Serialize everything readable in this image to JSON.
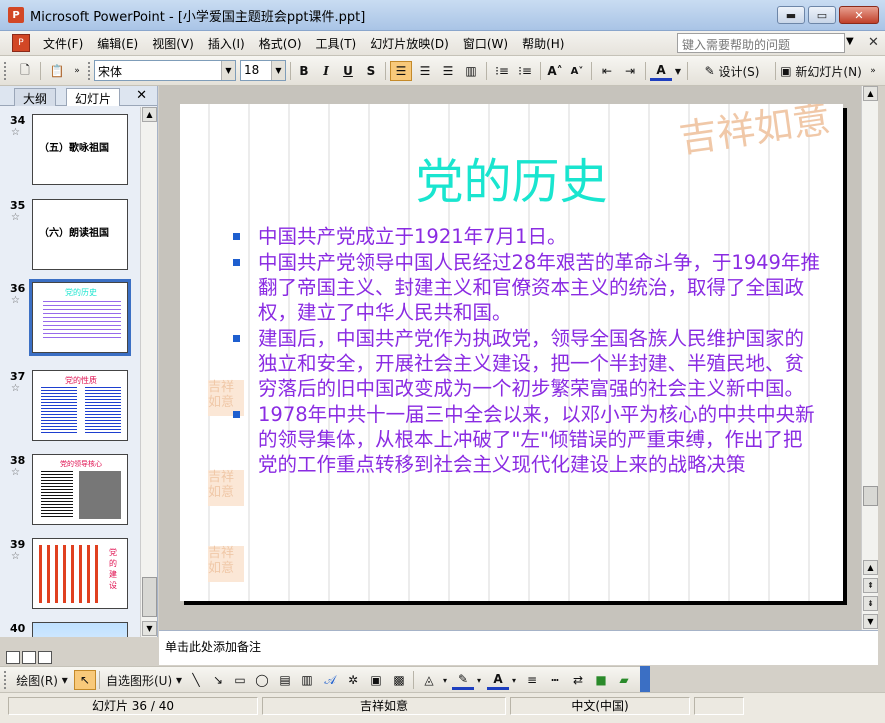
{
  "window": {
    "title": "Microsoft PowerPoint - [小学爱国主题班会ppt课件.ppt]",
    "minimize_label": "▭",
    "restore_label": "⧉",
    "close_label": "✕"
  },
  "menu": {
    "items": [
      "文件(F)",
      "编辑(E)",
      "视图(V)",
      "插入(I)",
      "格式(O)",
      "工具(T)",
      "幻灯片放映(D)",
      "窗口(W)",
      "帮助(H)"
    ],
    "help_placeholder": "键入需要帮助的问题",
    "close_glyph": "✕"
  },
  "toolbar": {
    "font_name": "宋体",
    "font_size": "18",
    "bold": "B",
    "italic": "I",
    "underline": "U",
    "shadow": "S",
    "font_color_label": "A",
    "design_label": "设计(S)",
    "new_slide_label": "新幻灯片(N)"
  },
  "left_panel": {
    "tab_outline": "大纲",
    "tab_slides": "幻灯片",
    "close_glyph": "✕",
    "thumbnails": [
      {
        "num": "34",
        "title": "（五）歌咏祖国"
      },
      {
        "num": "35",
        "title": "（六）朗读祖国"
      },
      {
        "num": "36",
        "title": "党的历史"
      },
      {
        "num": "37",
        "title": "党的性质"
      },
      {
        "num": "38",
        "title": "党的领导核心"
      },
      {
        "num": "39",
        "title": "党的建设"
      },
      {
        "num": "40",
        "title": ""
      }
    ]
  },
  "slide": {
    "title": "党的历史",
    "bullets": [
      " 中国共产党成立于1921年7月1日。",
      "中国共产党领导中国人民经过28年艰苦的革命斗争，于1949年推翻了帝国主义、封建主义和官僚资本主义的统治，取得了全国政权，建立了中华人民共和国。",
      "建国后，中国共产党作为执政党，领导全国各族人民维护国家的独立和安全，开展社会主义建设，把一个半封建、半殖民地、贫穷落后的旧中国改变成为一个初步繁荣富强的社会主义新中国。",
      "1978年中共十一届三中全会以来，以邓小平为核心的中共中央新的领导集体，从根本上冲破了\"左\"倾错误的严重束缚，作出了把党的工作重点转移到社会主义现代化建设上来的战略决策"
    ],
    "stamp_text": "吉祥如意"
  },
  "notes": {
    "placeholder": "单击此处添加备注"
  },
  "drawbar": {
    "draw_label": "绘图(R)",
    "autoshapes_label": "自选图形(U)"
  },
  "status": {
    "slide_info": "幻灯片 36 / 40",
    "design_name": "吉祥如意",
    "language": "中文(中国)"
  }
}
